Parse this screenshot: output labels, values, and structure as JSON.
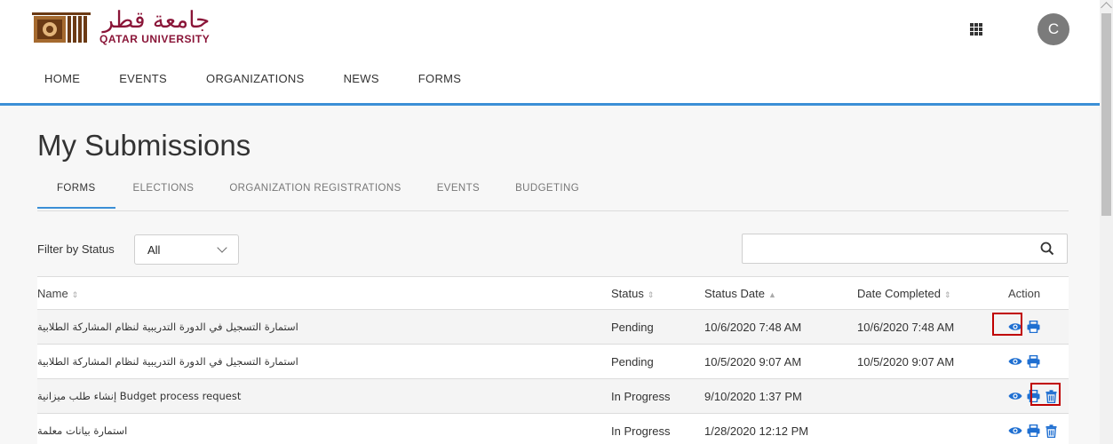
{
  "header": {
    "logo_arabic": "جامعة قطر",
    "logo_english": "QATAR UNIVERSITY",
    "apps_icon": "grid-icon",
    "avatar_initial": "C"
  },
  "nav": {
    "items": [
      {
        "label": "HOME",
        "active": true
      },
      {
        "label": "EVENTS"
      },
      {
        "label": "ORGANIZATIONS"
      },
      {
        "label": "NEWS"
      },
      {
        "label": "FORMS"
      }
    ]
  },
  "page": {
    "title": "My Submissions",
    "tabs": [
      {
        "label": "FORMS",
        "active": true
      },
      {
        "label": "ELECTIONS"
      },
      {
        "label": "ORGANIZATION REGISTRATIONS"
      },
      {
        "label": "EVENTS"
      },
      {
        "label": "BUDGETING"
      }
    ]
  },
  "filter": {
    "label": "Filter by Status",
    "selected": "All"
  },
  "search": {
    "placeholder": "",
    "icon": "search-icon"
  },
  "table": {
    "headers": {
      "name": "Name",
      "status": "Status",
      "status_date": "Status Date",
      "date_completed": "Date Completed",
      "action": "Action"
    },
    "rows": [
      {
        "name": "استمارة التسجيل في الدورة التدريبية لنظام المشاركة الطلابية",
        "status": "Pending",
        "status_date": "10/6/2020 7:48 AM",
        "date_completed": "10/6/2020 7:48 AM"
      },
      {
        "name": "استمارة التسجيل في الدورة التدريبية لنظام المشاركة الطلابية",
        "status": "Pending",
        "status_date": "10/5/2020 9:07 AM",
        "date_completed": "10/5/2020 9:07 AM"
      },
      {
        "name": "إنشاء طلب ميزانية Budget process request",
        "status": "In Progress",
        "status_date": "9/10/2020 1:37 PM",
        "date_completed": ""
      },
      {
        "name": "استمارة بيانات معلمة",
        "status": "In Progress",
        "status_date": "1/28/2020 12:12 PM",
        "date_completed": ""
      }
    ]
  },
  "colors": {
    "accent": "#3b8fd6",
    "brand": "#8a1538",
    "action_icon": "#1f6fd1",
    "highlight": "#c00000"
  }
}
